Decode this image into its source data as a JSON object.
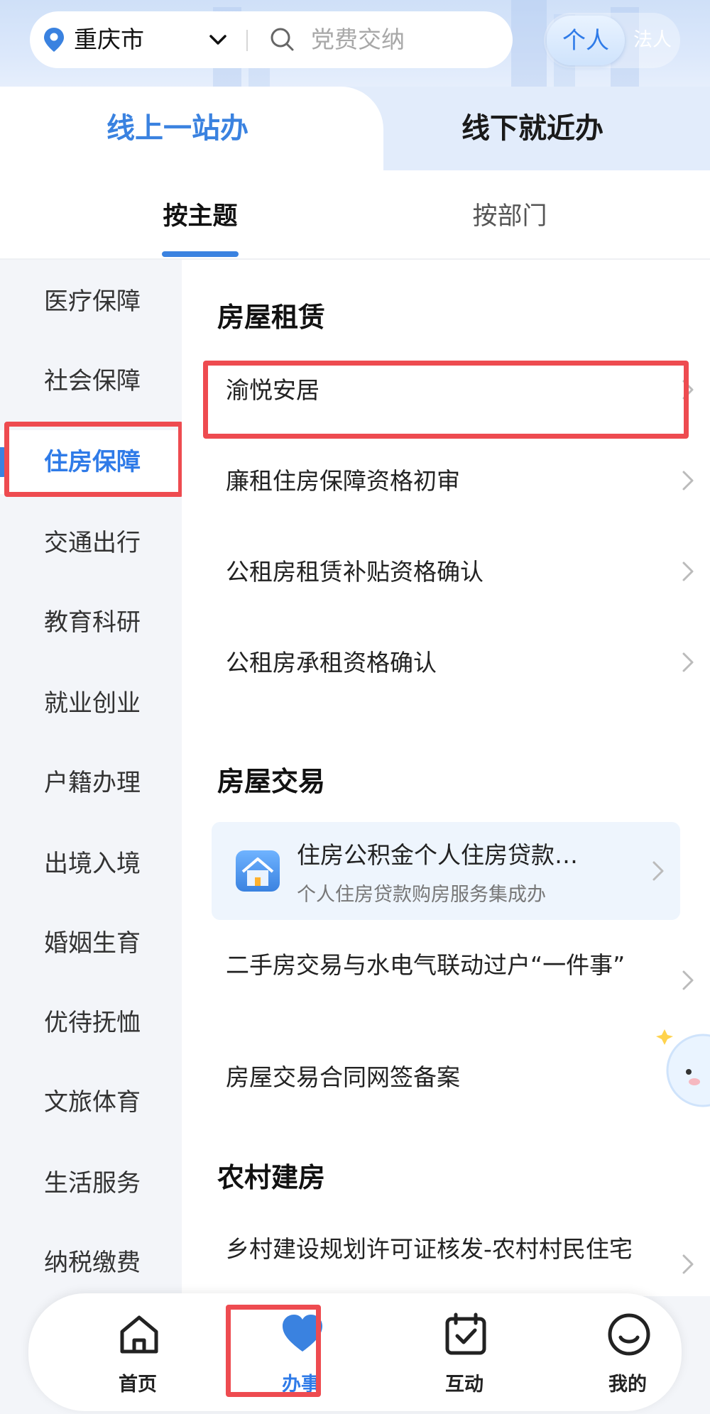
{
  "header": {
    "city": "重庆市",
    "search_placeholder": "党费交纳",
    "role_personal": "个人",
    "role_legal": "法人"
  },
  "main_tabs": {
    "online": "线上一站办",
    "offline": "线下就近办"
  },
  "sub_tabs": {
    "by_theme": "按主题",
    "by_department": "按部门"
  },
  "sidebar": {
    "active_index": 2,
    "items": [
      {
        "label": "医疗保障"
      },
      {
        "label": "社会保障"
      },
      {
        "label": "住房保障"
      },
      {
        "label": "交通出行"
      },
      {
        "label": "教育科研"
      },
      {
        "label": "就业创业"
      },
      {
        "label": "户籍办理"
      },
      {
        "label": "出境入境"
      },
      {
        "label": "婚姻生育"
      },
      {
        "label": "优待抚恤"
      },
      {
        "label": "文旅体育"
      },
      {
        "label": "生活服务"
      },
      {
        "label": "纳税缴费"
      }
    ]
  },
  "sections": {
    "rental": {
      "title": "房屋租赁",
      "items": [
        "渝悦安居",
        "廉租住房保障资格初审",
        "公租房租赁补贴资格确认",
        "公租房承租资格确认"
      ]
    },
    "trade": {
      "title": "房屋交易",
      "feature_title": "住房公积金个人住房贷款…",
      "feature_subtitle": "个人住房贷款购房服务集成办",
      "items": [
        "二手房交易与水电气联动过户“一件事”",
        "房屋交易合同网签备案"
      ]
    },
    "rural": {
      "title": "农村建房",
      "items": [
        "乡村建设规划许可证核发-农村村民住宅"
      ]
    }
  },
  "bottom_nav": {
    "home": "首页",
    "services": "办事",
    "interact": "互动",
    "mine": "我的"
  },
  "colors": {
    "accent": "#3a82e0",
    "highlight": "#ee4b50",
    "sidebar_bg": "#f3f5f9",
    "card_bg": "#eef5fd"
  }
}
